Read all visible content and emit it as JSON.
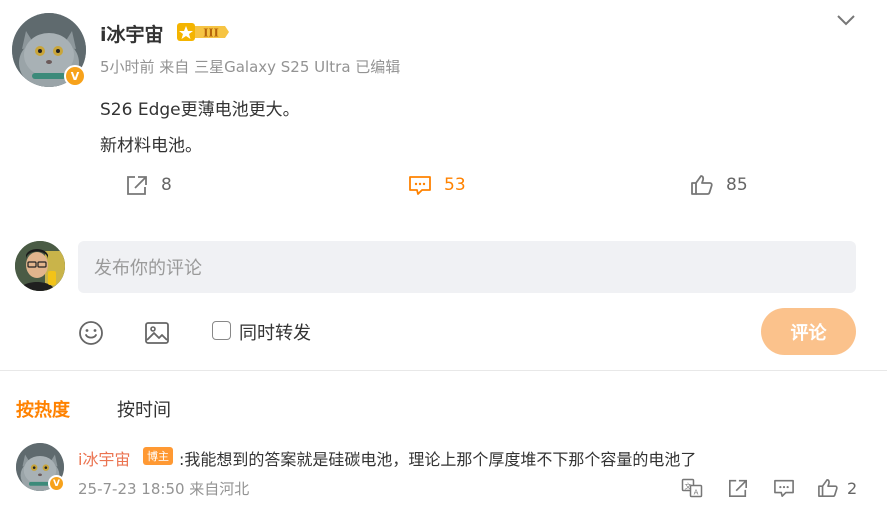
{
  "post": {
    "author": "i冰宇宙",
    "meta": "5小时前 来自 三星Galaxy S25 Ultra 已编辑",
    "lines": [
      "S26 Edge更薄电池更大。",
      "新材料电池。"
    ],
    "actions": {
      "share": "8",
      "comment": "53",
      "like": "85"
    }
  },
  "composer": {
    "placeholder": "发布你的评论",
    "repost_label": "同时转发",
    "submit_label": "评论"
  },
  "sort": {
    "hot": "按热度",
    "time": "按时间"
  },
  "comments": [
    {
      "author": "i冰宇宙",
      "tag": "博主",
      "text": ":我能想到的答案就是硅碳电池，理论上那个厚度堆不下那个容量的电池了",
      "meta": "25-7-23 18:50 来自河北",
      "likes": "2"
    }
  ],
  "colors": {
    "accent": "#ff8200",
    "submit_disabled": "#fbc28c",
    "name_link": "#eb7350",
    "vip_gold": "#f7a21b"
  }
}
